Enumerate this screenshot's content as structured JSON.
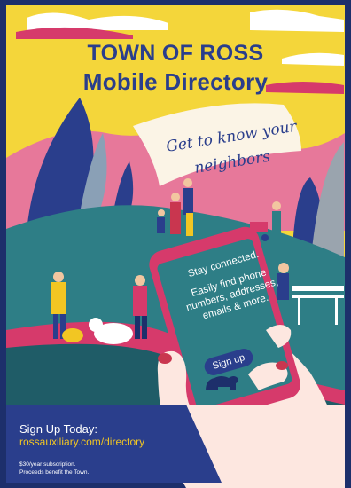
{
  "title": {
    "line1": "TOWN OF ROSS",
    "line2": "Mobile Directory"
  },
  "tagline": {
    "line1": "Get to know your",
    "line2": "neighbors"
  },
  "phone": {
    "line1": "Stay connected.",
    "line2": "Easily find phone numbers, addresses, emails & more.",
    "button_label": "Sign up",
    "logo_icon": "bear-icon"
  },
  "footer": {
    "heading": "Sign Up Today:",
    "link": "rossauxiliary.com/directory",
    "fine_print_1": "$30/year subscription.",
    "fine_print_2": "Proceeds benefit the Town."
  },
  "colors": {
    "border": "#1d2f6b",
    "sky": "#f4d63a",
    "navy": "#2a3e8c",
    "teal": "#2e7e86",
    "pink": "#d63a6b",
    "accent": "#f2c623"
  }
}
